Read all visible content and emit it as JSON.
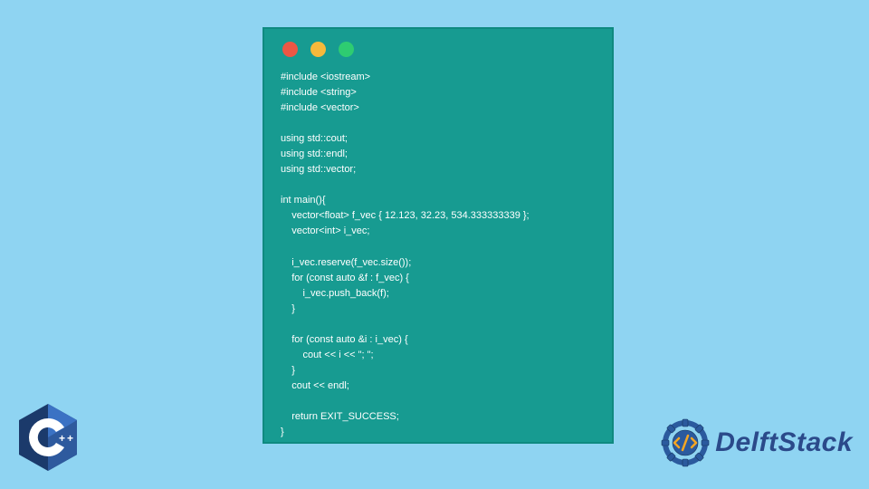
{
  "code": {
    "lines": "#include <iostream>\n#include <string>\n#include <vector>\n\nusing std::cout;\nusing std::endl;\nusing std::vector;\n\nint main(){\n    vector<float> f_vec { 12.123, 32.23, 534.333333339 };\n    vector<int> i_vec;\n\n    i_vec.reserve(f_vec.size());\n    for (const auto &f : f_vec) {\n        i_vec.push_back(f);\n    }\n\n    for (const auto &i : i_vec) {\n        cout << i << \"; \";\n    }\n    cout << endl;\n\n    return EXIT_SUCCESS;\n}"
  },
  "branding": {
    "cpp_label": "C++",
    "delft_label": "DelftStack"
  },
  "colors": {
    "page_bg": "#8fd4f2",
    "window_bg": "#179b91",
    "dot_red": "#ec5744",
    "dot_yellow": "#f6b93b",
    "dot_green": "#2ecc71",
    "code_text": "#ffffff",
    "brand_blue": "#2b4a8a"
  }
}
